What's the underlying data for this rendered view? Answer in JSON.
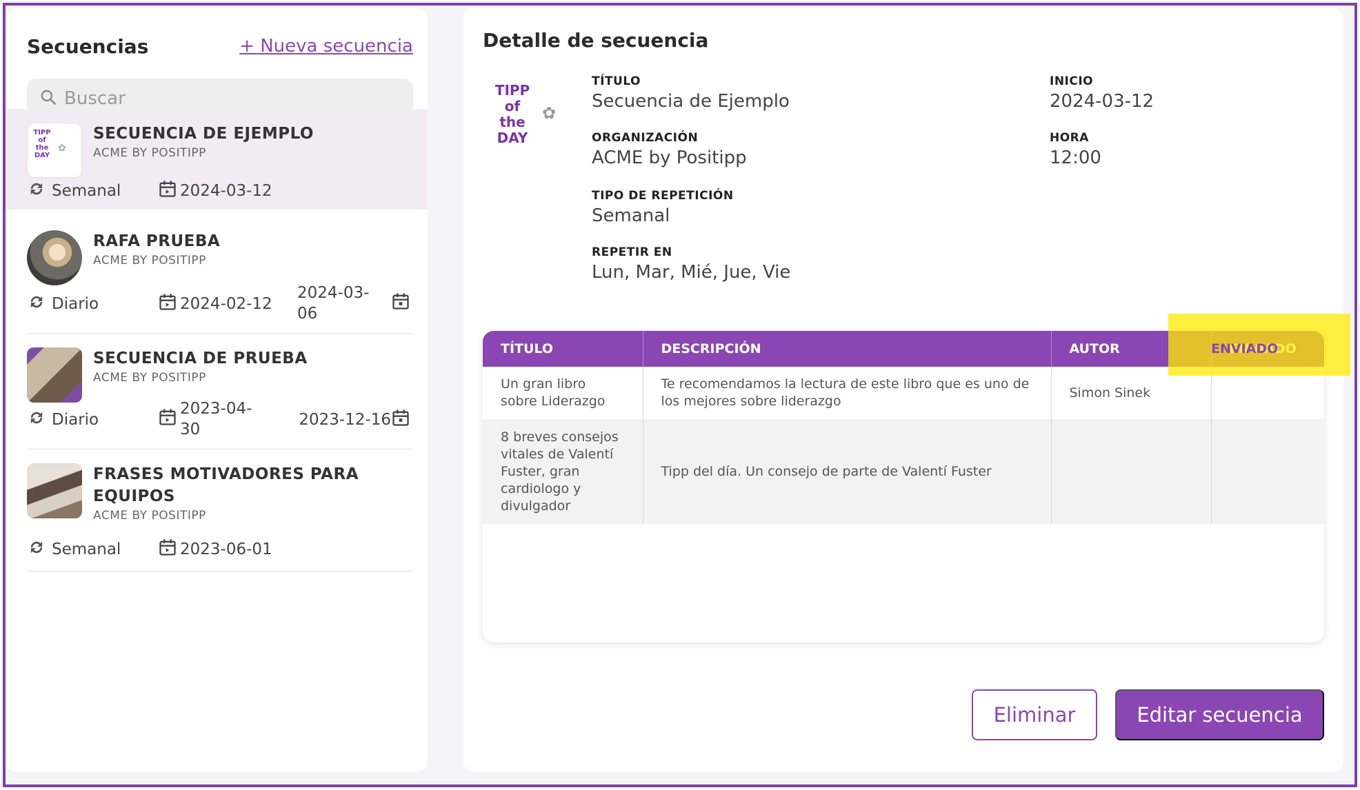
{
  "sidebar": {
    "title": "Secuencias",
    "new_link": "+ Nueva secuencia",
    "search_placeholder": "Buscar",
    "items": [
      {
        "name": "SECUENCIA DE EJEMPLO",
        "org": "ACME BY POSITIPP",
        "repeat": "Semanal",
        "start": "2024-03-12",
        "end": ""
      },
      {
        "name": "RAFA PRUEBA",
        "org": "ACME BY POSITIPP",
        "repeat": "Diario",
        "start": "2024-02-12",
        "end": "2024-03-06"
      },
      {
        "name": "SECUENCIA DE PRUEBA",
        "org": "ACME BY POSITIPP",
        "repeat": "Diario",
        "start": "2023-04-30",
        "end": "2023-12-16"
      },
      {
        "name": "FRASES MOTIVADORES PARA EQUIPOS",
        "org": "ACME BY POSITIPP",
        "repeat": "Semanal",
        "start": "2023-06-01",
        "end": ""
      }
    ],
    "thumb_logo_text": [
      "TIPP",
      "of",
      "the",
      "DAY"
    ]
  },
  "detail": {
    "title": "Detalle de secuencia",
    "logo_text": [
      "TIPP",
      "of",
      "the",
      "DAY"
    ],
    "fields": {
      "titulo_label": "TÍTULO",
      "titulo_value": "Secuencia de Ejemplo",
      "inicio_label": "INICIO",
      "inicio_value": "2024-03-12",
      "org_label": "ORGANIZACIÓN",
      "org_value": "ACME by Positipp",
      "hora_label": "HORA",
      "hora_value": "12:00",
      "tipo_label": "TIPO DE REPETICIÓN",
      "tipo_value": "Semanal",
      "repetir_label": "REPETIR EN",
      "repetir_value": "Lun, Mar, Mié, Jue, Vie"
    },
    "table": {
      "headers": [
        "TÍTULO",
        "DESCRIPCIÓN",
        "AUTOR",
        "ENVIADO"
      ],
      "rows": [
        [
          "Un gran libro sobre Liderazgo",
          "Te recomendamos la lectura de este libro que es uno de los mejores sobre liderazgo",
          "Simon Sinek",
          ""
        ],
        [
          "8 breves consejos vitales de Valentí Fuster, gran cardiologo y divulgador",
          "Tipp del día. Un consejo de parte de Valentí Fuster",
          "",
          ""
        ]
      ]
    },
    "buttons": {
      "delete": "Eliminar",
      "edit": "Editar secuencia"
    }
  },
  "colors": {
    "accent": "#8a46b3",
    "selected_bg": "#f2ebf6",
    "highlight": "#ffeb00"
  }
}
